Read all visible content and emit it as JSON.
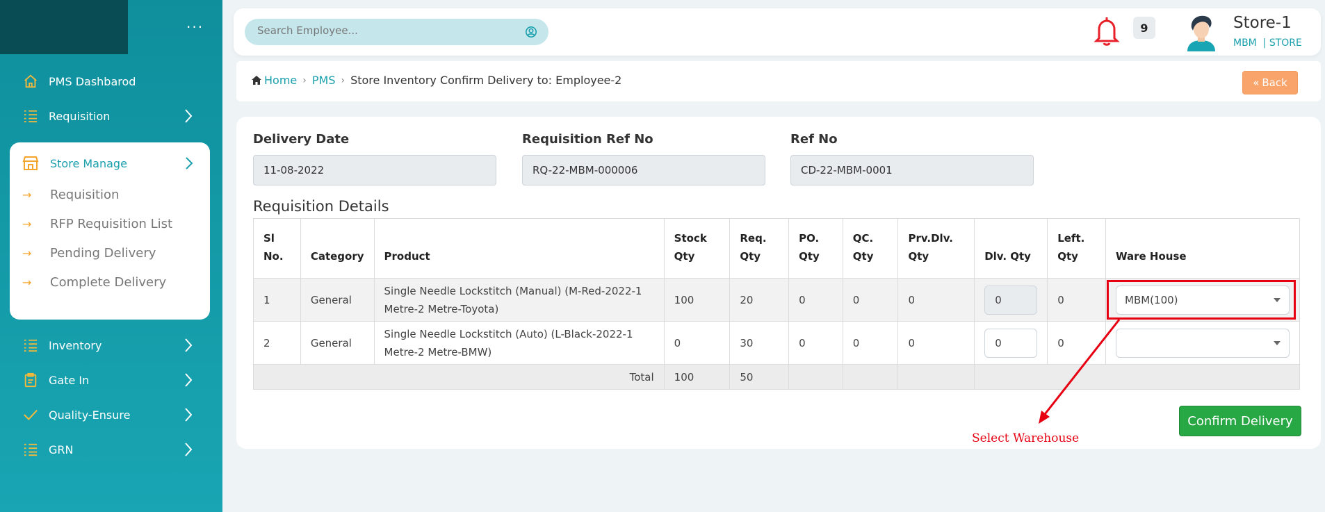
{
  "sidebar": {
    "menu_dots": "···",
    "items": [
      {
        "label": "PMS Dashbarod",
        "icon": "home-icon"
      },
      {
        "label": "Requisition",
        "icon": "list-icon"
      },
      {
        "label": "Inventory",
        "icon": "list-icon"
      },
      {
        "label": "Gate In",
        "icon": "clipboard-icon"
      },
      {
        "label": "Quality-Ensure",
        "icon": "check-icon"
      },
      {
        "label": "GRN",
        "icon": "list-icon"
      }
    ],
    "active_group": {
      "label": "Store Manage",
      "icon": "store-icon",
      "children": [
        "Requisition",
        "RFP Requisition List",
        "Pending Delivery",
        "Complete Delivery"
      ]
    }
  },
  "topbar": {
    "search_placeholder": "Search Employee...",
    "notification_count": "9",
    "user_name": "Store-1",
    "user_sub": "MBM  | STORE"
  },
  "breadcrumb": {
    "home": "Home",
    "pms": "PMS",
    "current": "Store Inventory Confirm Delivery to: Employee-2",
    "back_label": "Back"
  },
  "form": {
    "delivery_date_label": "Delivery Date",
    "delivery_date": "11-08-2022",
    "req_ref_label": "Requisition Ref No",
    "req_ref": "RQ-22-MBM-000006",
    "ref_label": "Ref No",
    "ref": "CD-22-MBM-0001"
  },
  "details": {
    "title": "Requisition Details",
    "headers": {
      "sl_1": "Sl",
      "sl_2": "No.",
      "category": "Category",
      "product": "Product",
      "stock_1": "Stock",
      "stock_2": "Qty",
      "req_1": "Req.",
      "req_2": "Qty",
      "po_1": "PO.",
      "po_2": "Qty",
      "qc_1": "QC.",
      "qc_2": "Qty",
      "prv_1": "Prv.Dlv.",
      "prv_2": "Qty",
      "dlv": "Dlv. Qty",
      "left_1": "Left.",
      "left_2": "Qty",
      "warehouse": "Ware House"
    },
    "rows": [
      {
        "sl": "1",
        "category": "General",
        "product": "Single Needle Lockstitch (Manual) (M-Red-2022-1 Metre-2 Metre-Toyota)",
        "stock": "100",
        "req": "20",
        "po": "0",
        "qc": "0",
        "prv": "0",
        "dlv": "0",
        "left": "0",
        "warehouse": "MBM(100)"
      },
      {
        "sl": "2",
        "category": "General",
        "product": "Single Needle Lockstitch (Auto) (L-Black-2022-1 Metre-2 Metre-BMW)",
        "stock": "0",
        "req": "30",
        "po": "0",
        "qc": "0",
        "prv": "0",
        "dlv": "0",
        "left": "0",
        "warehouse": ""
      }
    ],
    "total_label": "Total",
    "total_stock": "100",
    "total_req": "50"
  },
  "annotation": "Select Warehouse",
  "confirm_label": "Confirm Delivery",
  "colors": {
    "accent": "#1aa0ad",
    "sidebar": "#19a3b4",
    "confirm": "#28a745",
    "back": "#f8a46b",
    "annotation": "#e60012"
  }
}
